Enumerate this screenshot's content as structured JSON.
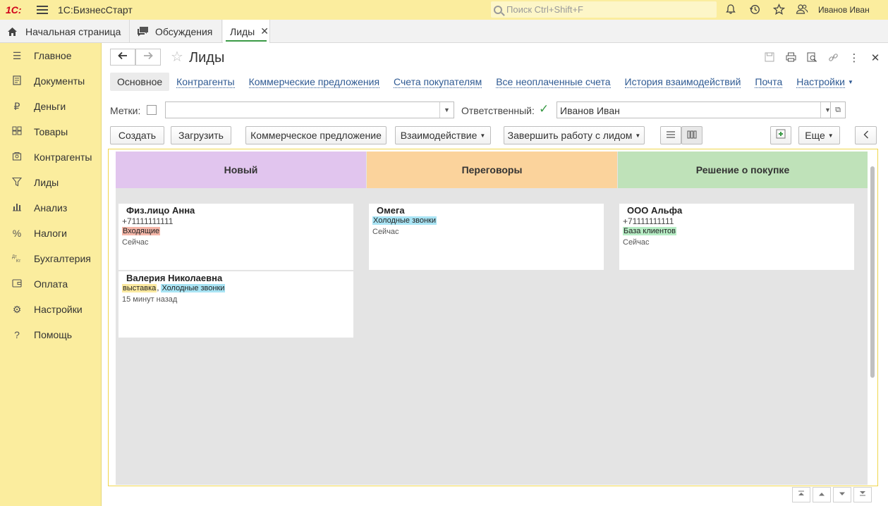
{
  "app": {
    "logo": "1С:",
    "title": "1С:БизнесСтарт",
    "search_placeholder": "Поиск Ctrl+Shift+F",
    "user": "Иванов Иван"
  },
  "tabs": [
    {
      "label": "Начальная страница"
    },
    {
      "label": "Обсуждения"
    },
    {
      "label": "Лиды"
    }
  ],
  "sidebar": {
    "items": [
      {
        "label": "Главное"
      },
      {
        "label": "Документы"
      },
      {
        "label": "Деньги"
      },
      {
        "label": "Товары"
      },
      {
        "label": "Контрагенты"
      },
      {
        "label": "Лиды"
      },
      {
        "label": "Анализ"
      },
      {
        "label": "Налоги"
      },
      {
        "label": "Бухгалтерия"
      },
      {
        "label": "Оплата"
      },
      {
        "label": "Настройки"
      },
      {
        "label": "Помощь"
      }
    ]
  },
  "form": {
    "title": "Лиды",
    "nav_links": [
      {
        "label": "Основное"
      },
      {
        "label": "Контрагенты"
      },
      {
        "label": "Коммерческие предложения"
      },
      {
        "label": "Счета покупателям"
      },
      {
        "label": "Все неоплаченные счета"
      },
      {
        "label": "История взаимодействий"
      },
      {
        "label": "Почта"
      },
      {
        "label": "Настройки"
      }
    ],
    "filters": {
      "tags_label": "Метки:",
      "tags_value": "",
      "responsible_label": "Ответственный:",
      "responsible_value": "Иванов Иван"
    },
    "toolbar": {
      "create": "Создать",
      "load": "Загрузить",
      "commercial_offer": "Коммерческое предложение",
      "interaction": "Взаимодействие",
      "finish_lead": "Завершить работу с лидом",
      "more": "Еще"
    }
  },
  "kanban": {
    "columns": [
      {
        "title": "Новый",
        "color": "#e1c5ee",
        "cards": [
          {
            "title": "Физ.лицо Анна",
            "phone": "+71111111111",
            "tags": [
              {
                "text": "Входящие",
                "color": "#f4b6a8"
              }
            ],
            "time": "Сейчас"
          },
          {
            "title": "Валерия Николаевна",
            "phone": "",
            "tags": [
              {
                "text": "выставка",
                "color": "#fbe9a0"
              },
              {
                "text": "Холодные звонки",
                "color": "#a9e4f4"
              }
            ],
            "time": "15 минут назад"
          }
        ]
      },
      {
        "title": "Переговоры",
        "color": "#fbd39c",
        "cards": [
          {
            "title": "Омега",
            "phone": "",
            "tags": [
              {
                "text": "Холодные звонки",
                "color": "#a9e4f4"
              }
            ],
            "time": "Сейчас"
          }
        ]
      },
      {
        "title": "Решение о покупке",
        "color": "#bfe2b9",
        "cards": [
          {
            "title": "ООО Альфа",
            "phone": "+71111111111",
            "tags": [
              {
                "text": "База клиентов",
                "color": "#b6ecc4"
              }
            ],
            "time": "Сейчас"
          }
        ]
      }
    ]
  }
}
